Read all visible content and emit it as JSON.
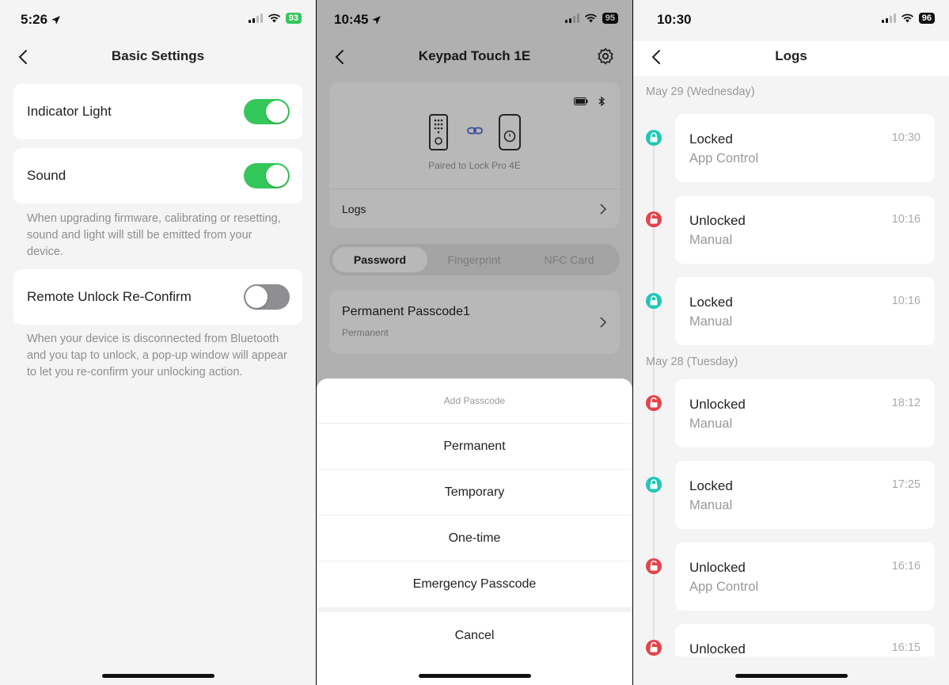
{
  "screen1": {
    "time": "5:26",
    "battery": "93",
    "title": "Basic Settings",
    "indicator_light": "Indicator Light",
    "sound": "Sound",
    "sound_note": "When upgrading firmware, calibrating or resetting, sound and light will still be emitted from your device.",
    "remote_unlock": "Remote Unlock Re-Confirm",
    "remote_note": "When your device is disconnected from Bluetooth and you tap to unlock, a pop-up window will appear to let you re-confirm your unlocking action."
  },
  "screen2": {
    "time": "10:45",
    "battery": "95",
    "title": "Keypad Touch 1E",
    "paired": "Paired to Lock Pro 4E",
    "logs": "Logs",
    "tabs": [
      "Password",
      "Fingerprint",
      "NFC Card"
    ],
    "passcode_title": "Permanent Passcode1",
    "passcode_sub": "Permanent",
    "sheet_title": "Add Passcode",
    "options": [
      "Permanent",
      "Temporary",
      "One-time",
      "Emergency Passcode"
    ],
    "cancel": "Cancel"
  },
  "screen3": {
    "time": "10:30",
    "battery": "96",
    "title": "Logs",
    "dates": [
      "May 29 (Wednesday)",
      "May 28 (Tuesday)"
    ],
    "entries": [
      {
        "status": "Locked",
        "method": "App Control",
        "time": "10:30",
        "kind": "locked"
      },
      {
        "status": "Unlocked",
        "method": "Manual",
        "time": "10:16",
        "kind": "unlocked"
      },
      {
        "status": "Locked",
        "method": "Manual",
        "time": "10:16",
        "kind": "locked"
      },
      {
        "status": "Unlocked",
        "method": "Manual",
        "time": "18:12",
        "kind": "unlocked"
      },
      {
        "status": "Locked",
        "method": "Manual",
        "time": "17:25",
        "kind": "locked"
      },
      {
        "status": "Unlocked",
        "method": "App Control",
        "time": "16:16",
        "kind": "unlocked"
      },
      {
        "status": "Unlocked",
        "method": "",
        "time": "16:15",
        "kind": "unlocked"
      }
    ]
  },
  "colors": {
    "toggle_on": "#34c759",
    "locked": "#1fc7b6",
    "unlocked": "#e5434a"
  }
}
